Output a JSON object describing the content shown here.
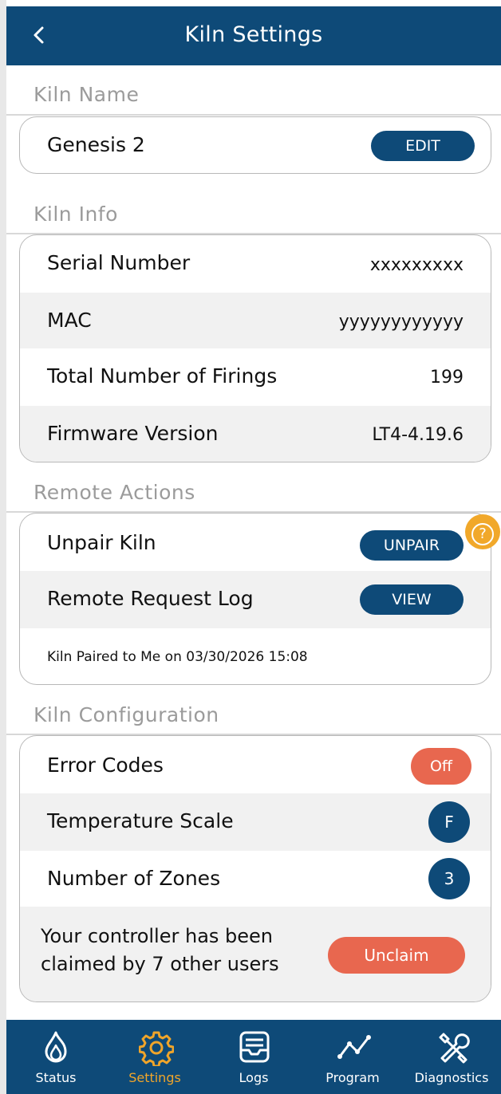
{
  "header": {
    "title": "Kiln Settings",
    "back_icon": "chevron-left-icon"
  },
  "sections": {
    "kiln_name": "Kiln Name",
    "kiln_info": "Kiln Info",
    "remote_actions": "Remote Actions",
    "kiln_configuration": "Kiln Configuration"
  },
  "kiln_name": {
    "value": "Genesis 2",
    "edit_label": "EDIT"
  },
  "kiln_info": {
    "serial_label": "Serial Number",
    "serial_value": "xxxxxxxxx",
    "mac_label": "MAC",
    "mac_value": "yyyyyyyyyyyy",
    "firings_label": "Total Number of Firings",
    "firings_value": "199",
    "firmware_label": "Firmware Version",
    "firmware_value": "LT4-4.19.6"
  },
  "remote_actions": {
    "unpair_label": "Unpair Kiln",
    "unpair_button": "UNPAIR",
    "log_label": "Remote Request Log",
    "view_button": "VIEW",
    "paired_text": "Kiln Paired to Me on 03/30/2026 15:08",
    "help_symbol": "?"
  },
  "kiln_configuration": {
    "error_codes_label": "Error Codes",
    "error_codes_value": "Off",
    "temp_scale_label": "Temperature Scale",
    "temp_scale_value": "F",
    "zones_label": "Number of Zones",
    "zones_value": "3",
    "claimed_line1": "Your controller has been",
    "claimed_line2": "claimed by 7 other users",
    "unclaim_button": "Unclaim"
  },
  "tabs": [
    {
      "label": "Status",
      "icon": "flame-icon"
    },
    {
      "label": "Settings",
      "icon": "gear-icon"
    },
    {
      "label": "Logs",
      "icon": "inbox-icon"
    },
    {
      "label": "Program",
      "icon": "graph-line-icon"
    },
    {
      "label": "Diagnostics",
      "icon": "tools-icon"
    }
  ],
  "colors": {
    "navy": "#0e4a78",
    "orange": "#e8674f",
    "active_tab": "#f0a52a",
    "help": "#f1a82a"
  }
}
